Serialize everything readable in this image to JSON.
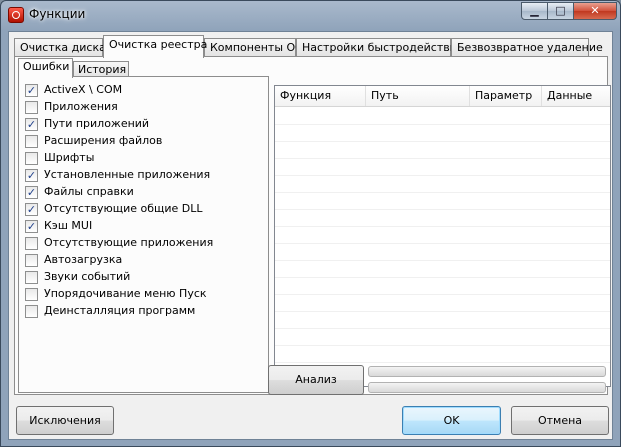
{
  "window": {
    "title": "Функции"
  },
  "title_controls": {
    "minimize": "▁",
    "maximize": "□",
    "close": "✕"
  },
  "tabs": [
    {
      "label": "Очистка диска",
      "active": false
    },
    {
      "label": "Очистка реестра",
      "active": true
    },
    {
      "label": "Компоненты ОС",
      "active": false
    },
    {
      "label": "Настройки быстродействия",
      "active": false
    },
    {
      "label": "Безвозвратное удаление",
      "active": false
    }
  ],
  "subtabs": [
    {
      "label": "Ошибки",
      "active": true
    },
    {
      "label": "История",
      "active": false
    }
  ],
  "check_items": [
    {
      "label": "ActiveX \\ COM",
      "checked": true
    },
    {
      "label": "Приложения",
      "checked": false
    },
    {
      "label": "Пути приложений",
      "checked": true
    },
    {
      "label": "Расширения файлов",
      "checked": false
    },
    {
      "label": "Шрифты",
      "checked": false
    },
    {
      "label": "Установленные приложения",
      "checked": true
    },
    {
      "label": "Файлы справки",
      "checked": true
    },
    {
      "label": "Отсутствующие общие DLL",
      "checked": true
    },
    {
      "label": "Кэш MUI",
      "checked": true
    },
    {
      "label": "Отсутствующие приложения",
      "checked": false
    },
    {
      "label": "Автозагрузка",
      "checked": false
    },
    {
      "label": "Звуки событий",
      "checked": false
    },
    {
      "label": "Упорядочивание меню Пуск",
      "checked": false
    },
    {
      "label": "Деинсталляция программ",
      "checked": false
    }
  ],
  "results_table": {
    "columns": [
      "Функция",
      "Путь",
      "Параметр",
      "Данные"
    ]
  },
  "analyze_button": "Анализ",
  "footer": {
    "exclusions_button": "Исключения",
    "ok_button": "OK",
    "cancel_button": "Отмена"
  },
  "check_mark": "✓"
}
